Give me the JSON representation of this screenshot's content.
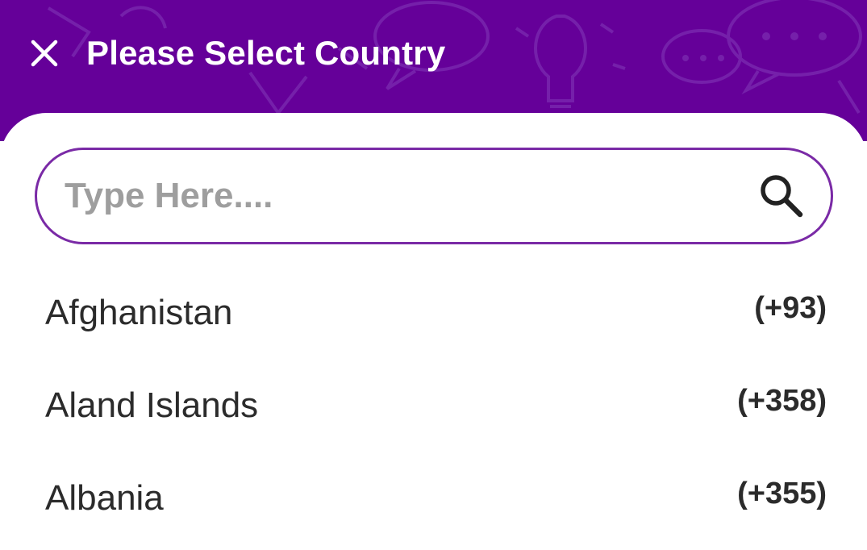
{
  "header": {
    "title": "Please Select Country",
    "close_icon": "close-icon",
    "background_color": "#650099"
  },
  "search": {
    "placeholder": "Type Here....",
    "value": "",
    "icon": "search-icon",
    "border_color": "#7a2aa6"
  },
  "countries": [
    {
      "name": "Afghanistan",
      "code": "(+93)"
    },
    {
      "name": "Aland Islands",
      "code": "(+358)"
    },
    {
      "name": "Albania",
      "code": "(+355)"
    }
  ]
}
